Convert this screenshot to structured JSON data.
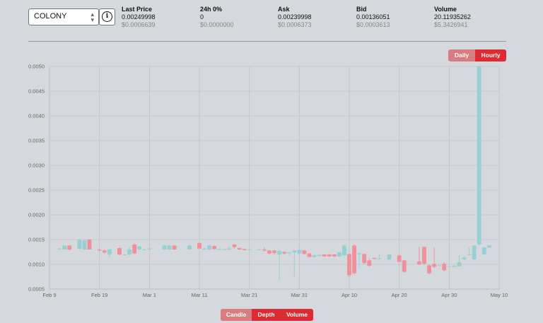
{
  "market": {
    "selected": "COLONY"
  },
  "stats": [
    {
      "label": "Last Price",
      "value": "0.00249998",
      "usd": "$0.0006639"
    },
    {
      "label": "24h 0%",
      "value": "0",
      "usd": "$0.0000000"
    },
    {
      "label": "Ask",
      "value": "0.00239998",
      "usd": "$0.0006373"
    },
    {
      "label": "Bid",
      "value": "0.00136051",
      "usd": "$0.0003613"
    },
    {
      "label": "Volume",
      "value": "20.11935262",
      "usd": "$5.3426941"
    }
  ],
  "timeframe": {
    "daily": "Daily",
    "hourly": "Hourly",
    "active": "hourly"
  },
  "views": {
    "candle": "Candle",
    "depth": "Depth",
    "volume": "Volume",
    "active": "candle"
  },
  "colors": {
    "up": "#96d0d2",
    "down": "#ef909b",
    "accent": "#dc2b33",
    "accent_dim": "#d97c80",
    "grid": "#bfc3c8"
  },
  "chart_data": {
    "type": "candlestick",
    "title": "",
    "xlabel": "",
    "ylabel": "",
    "ylim": [
      0.0005,
      0.005
    ],
    "yticks": [
      "0.0050",
      "0.0045",
      "0.0040",
      "0.0035",
      "0.0030",
      "0.0025",
      "0.0020",
      "0.0015",
      "0.0010",
      "0.0005"
    ],
    "xlim": [
      "2019-02-09",
      "2019-05-10"
    ],
    "xticks": [
      {
        "date": "2019-02-09",
        "label": "Feb 9"
      },
      {
        "date": "2019-02-19",
        "label": "Feb 19"
      },
      {
        "date": "2019-03-01",
        "label": "Mar 1"
      },
      {
        "date": "2019-03-11",
        "label": "Mar 11"
      },
      {
        "date": "2019-03-21",
        "label": "Mar 21"
      },
      {
        "date": "2019-03-31",
        "label": "Mar 31"
      },
      {
        "date": "2019-04-10",
        "label": "Apr 10"
      },
      {
        "date": "2019-04-20",
        "label": "Apr 20"
      },
      {
        "date": "2019-04-30",
        "label": "Apr 30"
      },
      {
        "date": "2019-05-10",
        "label": "May 10"
      }
    ],
    "grid": true,
    "candles": [
      {
        "date": "2019-02-11",
        "open": 0.00131,
        "close": 0.00132,
        "high": 0.00133,
        "low": 0.0013
      },
      {
        "date": "2019-02-12",
        "open": 0.0013,
        "close": 0.00138,
        "high": 0.00139,
        "low": 0.0013
      },
      {
        "date": "2019-02-13",
        "open": 0.00138,
        "close": 0.0013,
        "high": 0.00139,
        "low": 0.00128
      },
      {
        "date": "2019-02-15",
        "open": 0.00132,
        "close": 0.0015,
        "high": 0.0015,
        "low": 0.0013
      },
      {
        "date": "2019-02-16",
        "open": 0.0013,
        "close": 0.00148,
        "high": 0.0015,
        "low": 0.0013
      },
      {
        "date": "2019-02-17",
        "open": 0.0015,
        "close": 0.0013,
        "high": 0.0015,
        "low": 0.0013
      },
      {
        "date": "2019-02-19",
        "open": 0.0013,
        "close": 0.00128,
        "high": 0.00131,
        "low": 0.00126
      },
      {
        "date": "2019-02-20",
        "open": 0.00128,
        "close": 0.00124,
        "high": 0.0013,
        "low": 0.00122
      },
      {
        "date": "2019-02-21",
        "open": 0.0012,
        "close": 0.0013,
        "high": 0.00131,
        "low": 0.00114
      },
      {
        "date": "2019-02-23",
        "open": 0.00133,
        "close": 0.0012,
        "high": 0.00134,
        "low": 0.00118
      },
      {
        "date": "2019-02-24",
        "open": 0.0012,
        "close": 0.0012,
        "high": 0.00122,
        "low": 0.00118
      },
      {
        "date": "2019-02-25",
        "open": 0.0012,
        "close": 0.0013,
        "high": 0.00135,
        "low": 0.00118
      },
      {
        "date": "2019-02-26",
        "open": 0.0014,
        "close": 0.00122,
        "high": 0.00143,
        "low": 0.0012
      },
      {
        "date": "2019-02-27",
        "open": 0.0013,
        "close": 0.00136,
        "high": 0.00137,
        "low": 0.00129
      },
      {
        "date": "2019-02-28",
        "open": 0.0013,
        "close": 0.0013,
        "high": 0.00132,
        "low": 0.00128
      },
      {
        "date": "2019-03-01",
        "open": 0.0013,
        "close": 0.00132,
        "high": 0.00134,
        "low": 0.00128
      },
      {
        "date": "2019-03-04",
        "open": 0.0013,
        "close": 0.00138,
        "high": 0.00139,
        "low": 0.0013
      },
      {
        "date": "2019-03-05",
        "open": 0.0013,
        "close": 0.00138,
        "high": 0.00139,
        "low": 0.0013
      },
      {
        "date": "2019-03-06",
        "open": 0.00138,
        "close": 0.0013,
        "high": 0.00139,
        "low": 0.00129
      },
      {
        "date": "2019-03-09",
        "open": 0.0013,
        "close": 0.00138,
        "high": 0.00139,
        "low": 0.0013
      },
      {
        "date": "2019-03-11",
        "open": 0.00143,
        "close": 0.00132,
        "high": 0.00145,
        "low": 0.0013
      },
      {
        "date": "2019-03-12",
        "open": 0.0013,
        "close": 0.00132,
        "high": 0.00134,
        "low": 0.00129
      },
      {
        "date": "2019-03-13",
        "open": 0.0013,
        "close": 0.00138,
        "high": 0.00139,
        "low": 0.00129
      },
      {
        "date": "2019-03-14",
        "open": 0.00137,
        "close": 0.00131,
        "high": 0.00138,
        "low": 0.00129
      },
      {
        "date": "2019-03-15",
        "open": 0.0013,
        "close": 0.00131,
        "high": 0.00132,
        "low": 0.00129
      },
      {
        "date": "2019-03-16",
        "open": 0.0013,
        "close": 0.00131,
        "high": 0.00132,
        "low": 0.00129
      },
      {
        "date": "2019-03-17",
        "open": 0.0013,
        "close": 0.00132,
        "high": 0.00136,
        "low": 0.00129
      },
      {
        "date": "2019-03-18",
        "open": 0.0014,
        "close": 0.00135,
        "high": 0.00141,
        "low": 0.00132
      },
      {
        "date": "2019-03-19",
        "open": 0.00133,
        "close": 0.0013,
        "high": 0.00134,
        "low": 0.00129
      },
      {
        "date": "2019-03-20",
        "open": 0.00131,
        "close": 0.00129,
        "high": 0.00132,
        "low": 0.00128
      },
      {
        "date": "2019-03-21",
        "open": 0.0013,
        "close": 0.0013,
        "high": 0.00131,
        "low": 0.00129
      },
      {
        "date": "2019-03-23",
        "open": 0.0013,
        "close": 0.0013,
        "high": 0.00131,
        "low": 0.00129
      },
      {
        "date": "2019-03-24",
        "open": 0.0013,
        "close": 0.00128,
        "high": 0.00134,
        "low": 0.00126
      },
      {
        "date": "2019-03-25",
        "open": 0.00128,
        "close": 0.00122,
        "high": 0.00129,
        "low": 0.0012
      },
      {
        "date": "2019-03-26",
        "open": 0.00128,
        "close": 0.00123,
        "high": 0.00129,
        "low": 0.0012
      },
      {
        "date": "2019-03-27",
        "open": 0.0012,
        "close": 0.00127,
        "high": 0.00128,
        "low": 0.00067
      },
      {
        "date": "2019-03-28",
        "open": 0.00125,
        "close": 0.00122,
        "high": 0.00126,
        "low": 0.0012
      },
      {
        "date": "2019-03-29",
        "open": 0.00122,
        "close": 0.00124,
        "high": 0.00125,
        "low": 0.00118
      },
      {
        "date": "2019-03-30",
        "open": 0.00124,
        "close": 0.00128,
        "high": 0.00129,
        "low": 0.00075
      },
      {
        "date": "2019-03-31",
        "open": 0.00122,
        "close": 0.00129,
        "high": 0.0013,
        "low": 0.0012
      },
      {
        "date": "2019-04-01",
        "open": 0.00128,
        "close": 0.00121,
        "high": 0.00129,
        "low": 0.0012
      },
      {
        "date": "2019-04-02",
        "open": 0.00122,
        "close": 0.00115,
        "high": 0.00123,
        "low": 0.00114
      },
      {
        "date": "2019-04-03",
        "open": 0.00115,
        "close": 0.00118,
        "high": 0.0012,
        "low": 0.00113
      },
      {
        "date": "2019-04-04",
        "open": 0.00117,
        "close": 0.00119,
        "high": 0.0012,
        "low": 0.00116
      },
      {
        "date": "2019-04-05",
        "open": 0.0012,
        "close": 0.00116,
        "high": 0.00121,
        "low": 0.00115
      },
      {
        "date": "2019-04-06",
        "open": 0.0012,
        "close": 0.00116,
        "high": 0.00121,
        "low": 0.00115
      },
      {
        "date": "2019-04-07",
        "open": 0.0012,
        "close": 0.00116,
        "high": 0.00121,
        "low": 0.00115
      },
      {
        "date": "2019-04-08",
        "open": 0.00116,
        "close": 0.00124,
        "high": 0.00125,
        "low": 0.00115
      },
      {
        "date": "2019-04-09",
        "open": 0.00118,
        "close": 0.00138,
        "high": 0.0014,
        "low": 0.00117
      },
      {
        "date": "2019-04-10",
        "open": 0.00121,
        "close": 0.00078,
        "high": 0.00122,
        "low": 0.00073
      },
      {
        "date": "2019-04-11",
        "open": 0.00138,
        "close": 0.00082,
        "high": 0.0014,
        "low": 0.0008
      },
      {
        "date": "2019-04-12",
        "open": 0.0012,
        "close": 0.00122,
        "high": 0.00124,
        "low": 0.00093
      },
      {
        "date": "2019-04-13",
        "open": 0.00121,
        "close": 0.00103,
        "high": 0.00122,
        "low": 0.001
      },
      {
        "date": "2019-04-14",
        "open": 0.00108,
        "close": 0.00097,
        "high": 0.00112,
        "low": 0.00095
      },
      {
        "date": "2019-04-15",
        "open": 0.00113,
        "close": 0.00111,
        "high": 0.00114,
        "low": 0.0011
      },
      {
        "date": "2019-04-16",
        "open": 0.00111,
        "close": 0.00112,
        "high": 0.00121,
        "low": 0.0011
      },
      {
        "date": "2019-04-18",
        "open": 0.0011,
        "close": 0.0012,
        "high": 0.00121,
        "low": 0.00109
      },
      {
        "date": "2019-04-20",
        "open": 0.00118,
        "close": 0.00105,
        "high": 0.00119,
        "low": 0.00104
      },
      {
        "date": "2019-04-21",
        "open": 0.00108,
        "close": 0.00085,
        "high": 0.00109,
        "low": 0.00083
      },
      {
        "date": "2019-04-24",
        "open": 0.00106,
        "close": 0.001,
        "high": 0.00136,
        "low": 0.00099
      },
      {
        "date": "2019-04-25",
        "open": 0.00135,
        "close": 0.00101,
        "high": 0.00136,
        "low": 0.001
      },
      {
        "date": "2019-04-26",
        "open": 0.00098,
        "close": 0.00082,
        "high": 0.00099,
        "low": 0.0008
      },
      {
        "date": "2019-04-27",
        "open": 0.00101,
        "close": 0.00095,
        "high": 0.00134,
        "low": 0.00092
      },
      {
        "date": "2019-04-28",
        "open": 0.00098,
        "close": 0.00098,
        "high": 0.00099,
        "low": 0.00097
      },
      {
        "date": "2019-04-29",
        "open": 0.00101,
        "close": 0.00088,
        "high": 0.00104,
        "low": 0.00085
      },
      {
        "date": "2019-04-30",
        "open": 0.00096,
        "close": 0.00096,
        "high": 0.00097,
        "low": 0.00095
      },
      {
        "date": "2019-05-01",
        "open": 0.00095,
        "close": 0.00097,
        "high": 0.00098,
        "low": 0.00094
      },
      {
        "date": "2019-05-02",
        "open": 0.00096,
        "close": 0.00104,
        "high": 0.00118,
        "low": 0.00095
      },
      {
        "date": "2019-05-03",
        "open": 0.0011,
        "close": 0.00114,
        "high": 0.00115,
        "low": 0.00108
      },
      {
        "date": "2019-05-04",
        "open": 0.0012,
        "close": 0.0012,
        "high": 0.00134,
        "low": 0.00118
      },
      {
        "date": "2019-05-05",
        "open": 0.0011,
        "close": 0.00138,
        "high": 0.00139,
        "low": 0.00109
      },
      {
        "date": "2019-05-06",
        "open": 0.0014,
        "close": 0.005,
        "high": 0.005,
        "low": 0.00138
      },
      {
        "date": "2019-05-07",
        "open": 0.0012,
        "close": 0.00134,
        "high": 0.00135,
        "low": 0.00119
      },
      {
        "date": "2019-05-08",
        "open": 0.00134,
        "close": 0.00138,
        "high": 0.00139,
        "low": 0.00133
      }
    ]
  }
}
